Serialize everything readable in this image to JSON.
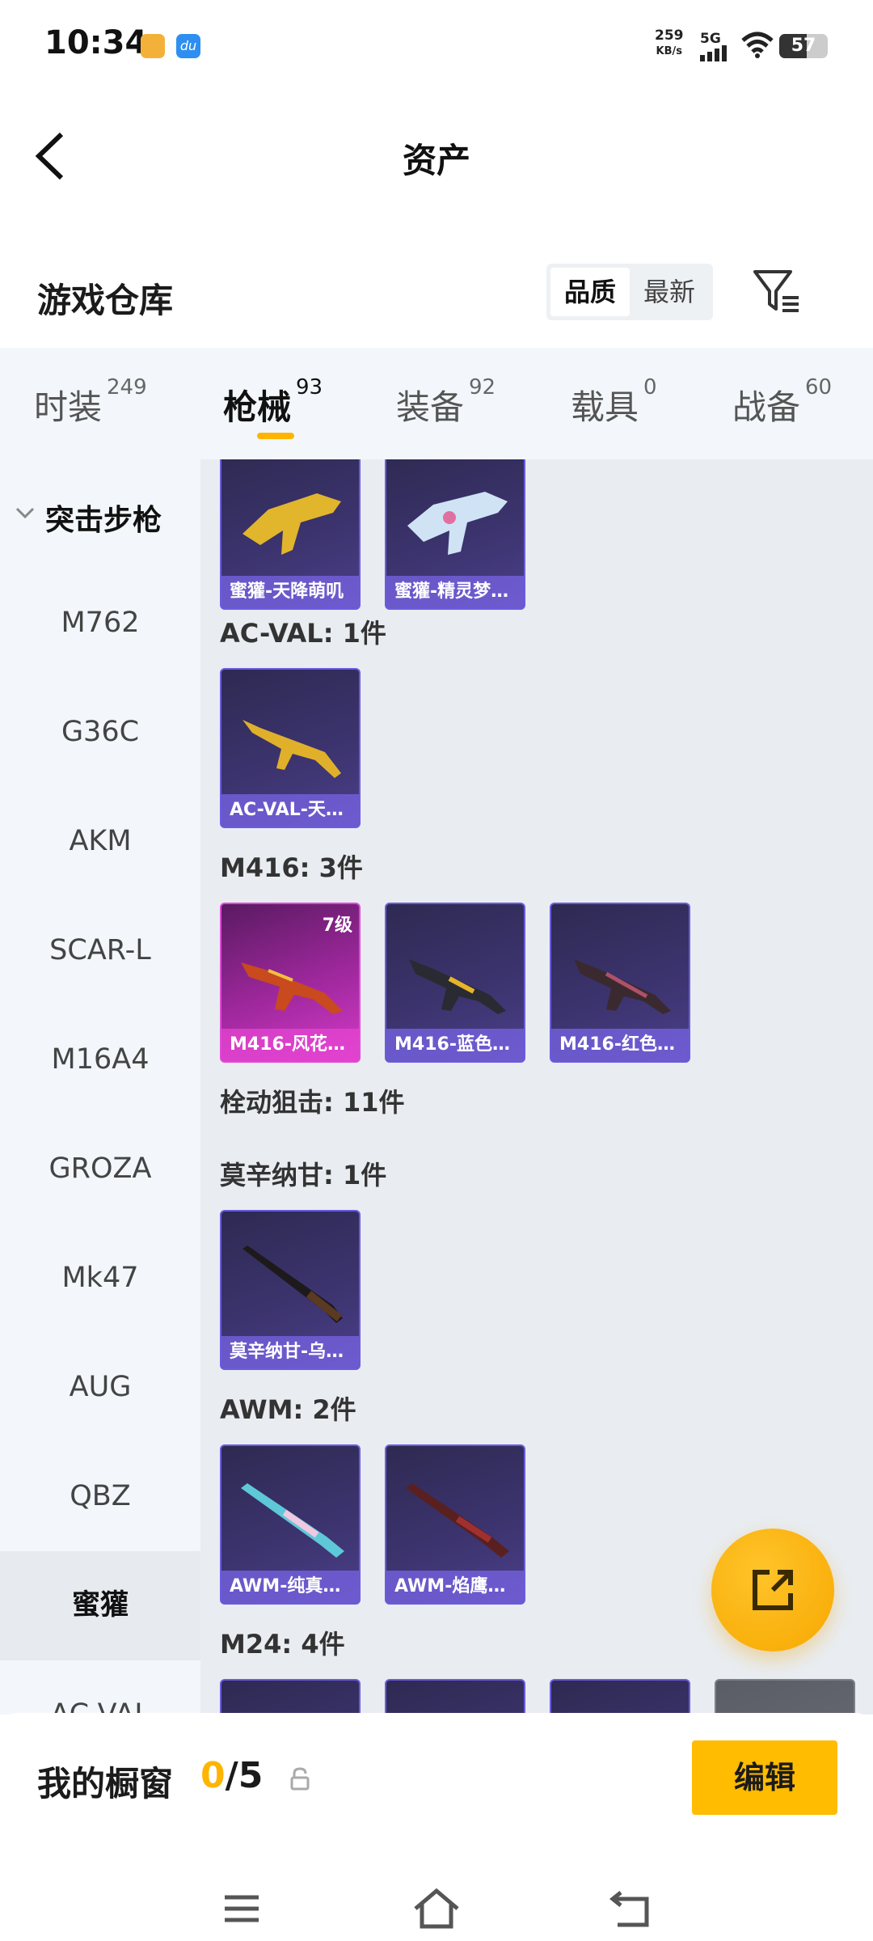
{
  "status": {
    "time": "10:34",
    "net_speed_value": "259",
    "net_speed_unit": "KB/s",
    "network": "5G",
    "battery": "57",
    "battery_level": 0.57
  },
  "header": {
    "title": "资产"
  },
  "warehouse": {
    "title": "游戏仓库",
    "sort_options": [
      "品质",
      "最新"
    ],
    "active_sort": "品质"
  },
  "tabs": [
    {
      "label": "时装",
      "count": "249"
    },
    {
      "label": "枪械",
      "count": "93"
    },
    {
      "label": "装备",
      "count": "92"
    },
    {
      "label": "载具",
      "count": "0"
    },
    {
      "label": "战备",
      "count": "60"
    }
  ],
  "active_tab": "枪械",
  "sidebar": {
    "category": "突击步枪",
    "items": [
      "M762",
      "G36C",
      "AKM",
      "SCAR-L",
      "M16A4",
      "GROZA",
      "Mk47",
      "AUG",
      "QBZ",
      "蜜獾",
      "AC-VAL"
    ],
    "active_item": "蜜獾"
  },
  "content": {
    "top_cards": [
      "蜜獾-天降萌叽",
      "蜜獾-精灵梦…"
    ],
    "groups": [
      {
        "title": "AC-VAL: 1件",
        "cards": [
          "AC-VAL-天…"
        ]
      },
      {
        "title": "M416: 3件",
        "cards": [
          "M416-风花…",
          "M416-蓝色…",
          "M416-红色…"
        ],
        "level_badge": "7级"
      },
      {
        "title": "栓动狙击: 11件",
        "cards": []
      },
      {
        "title": "莫辛纳甘: 1件",
        "cards": [
          "莫辛纳甘-乌…"
        ]
      },
      {
        "title": "AWM: 2件",
        "cards": [
          "AWM-纯真…",
          "AWM-焰鹰…"
        ]
      },
      {
        "title": "M24: 4件",
        "cards": []
      }
    ]
  },
  "showcase": {
    "label": "我的橱窗",
    "current": "0",
    "separator": "/",
    "max": "5",
    "edit_label": "编辑"
  },
  "colors": {
    "accent": "#ffb400",
    "card_purple": "#3d3470",
    "card_pink": "#a0289e"
  },
  "icons": [
    "back-icon",
    "filter-icon",
    "chevron-down-icon",
    "share-icon",
    "lock-icon",
    "menu-icon",
    "home-icon",
    "back-nav-icon"
  ]
}
